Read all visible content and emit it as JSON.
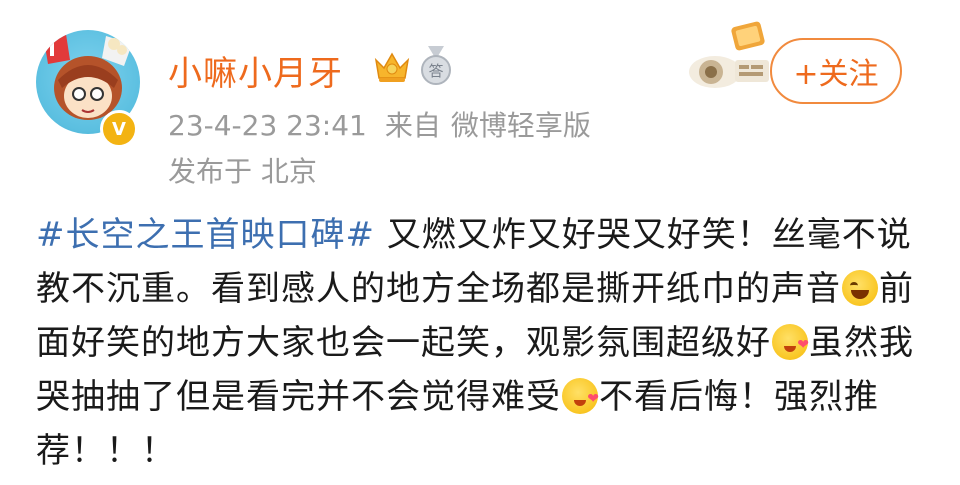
{
  "user": {
    "name": "小嘛小月牙",
    "verified_icon": "verified-v-icon",
    "crown_icon": "vip-crown-icon",
    "medal_icon": "medal-icon",
    "medal_text": "答"
  },
  "meta": {
    "date": "23-4-23 23:41",
    "source_prefix": "来自",
    "source": "微博轻享版",
    "location": "发布于 北京"
  },
  "follow_button": {
    "label": "+关注"
  },
  "post": {
    "hashtag": "#长空之王首映口碑#",
    "segment_1": " 又燃又炸又好哭又好笑！丝毫不说教不沉重。看到感人的地方全场都是撕开纸巾的声音",
    "segment_2": "前面好笑的地方大家也会一起笑，观影氛围超级好",
    "segment_3": "虽然我哭抽抽了但是看完并不会觉得难受",
    "segment_4": "不看后悔！强烈推荐！！！",
    "emojis": [
      "laugh-cry-emoji",
      "love-face-emoji",
      "love-face-emoji"
    ]
  },
  "colors": {
    "username": "#ee6a1d",
    "hashtag": "#3d6fb0",
    "meta": "#9a9a9a",
    "follow_border": "#f18a3e"
  }
}
